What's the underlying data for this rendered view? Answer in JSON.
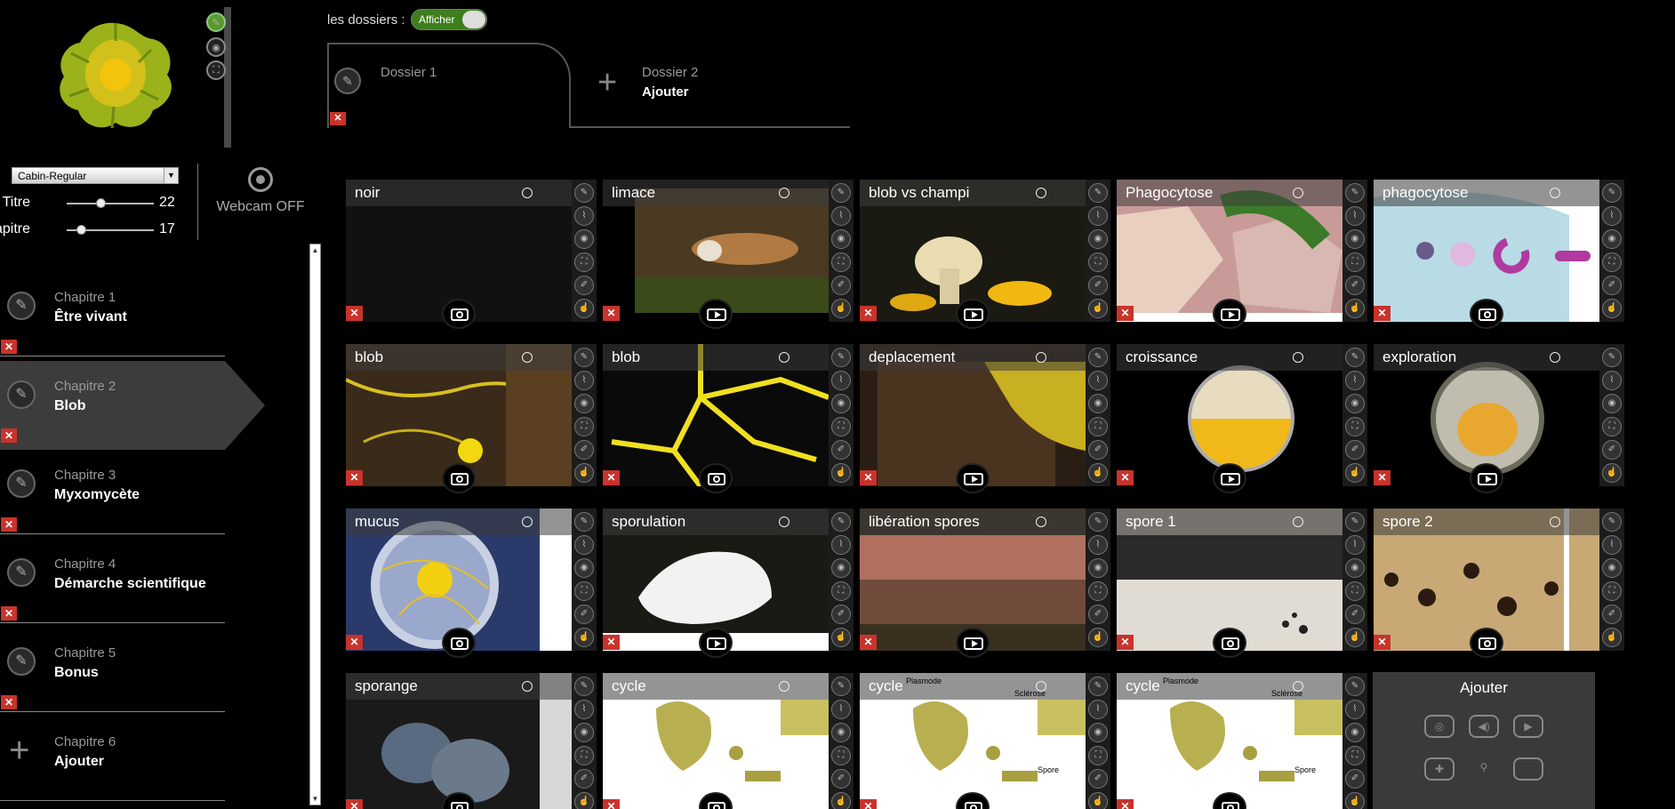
{
  "sidebar": {
    "font_select": "Cabin-Regular",
    "titre": {
      "label": "Titre",
      "value": "22"
    },
    "chapitre": {
      "label": "Chapitre",
      "value": "17"
    },
    "webcam": "Webcam OFF",
    "chapters": [
      {
        "num": "Chapitre 1",
        "name": "Être vivant"
      },
      {
        "num": "Chapitre 2",
        "name": "Blob"
      },
      {
        "num": "Chapitre 3",
        "name": "Myxomycète"
      },
      {
        "num": "Chapitre 4",
        "name": "Démarche scientifique"
      },
      {
        "num": "Chapitre 5",
        "name": "Bonus"
      },
      {
        "num": "Chapitre 6",
        "name": "Ajouter"
      }
    ]
  },
  "folders": {
    "label": "les dossiers :",
    "toggle": "Afficher",
    "tab1": {
      "num": "Dossier 1"
    },
    "tab2": {
      "num": "Dossier 2",
      "sub": "Ajouter"
    }
  },
  "cards": [
    {
      "title": "noir",
      "action": "camera"
    },
    {
      "title": "limace",
      "action": "play"
    },
    {
      "title": "blob vs champi",
      "action": "play"
    },
    {
      "title": "Phagocytose",
      "action": "play"
    },
    {
      "title": "phagocytose",
      "action": "camera"
    },
    {
      "title": "blob",
      "action": "camera"
    },
    {
      "title": "blob",
      "action": "camera"
    },
    {
      "title": "deplacement",
      "action": "play"
    },
    {
      "title": "croissance",
      "action": "play"
    },
    {
      "title": "exploration",
      "action": "play"
    },
    {
      "title": "mucus",
      "action": "camera"
    },
    {
      "title": "sporulation",
      "action": "play"
    },
    {
      "title": "libération spores",
      "action": "play"
    },
    {
      "title": "spore 1",
      "action": "camera"
    },
    {
      "title": "spore 2",
      "action": "camera"
    },
    {
      "title": "sporange",
      "action": "camera"
    },
    {
      "title": "cycle",
      "action": "camera"
    },
    {
      "title": "cycle",
      "action": "camera"
    },
    {
      "title": "cycle",
      "action": "camera"
    }
  ],
  "cycle_labels": {
    "top": "Plasmode",
    "right": "Sclérose",
    "right2": "Spore"
  },
  "add": {
    "title": "Ajouter",
    "icons": [
      "camera-icon",
      "speaker-icon",
      "video-icon",
      "gamepad-icon",
      "link-icon",
      "blank-icon"
    ]
  },
  "colors": {
    "delete": "#c8332b",
    "toggle": "#3e7e1c",
    "blob": "#e2c21e"
  }
}
